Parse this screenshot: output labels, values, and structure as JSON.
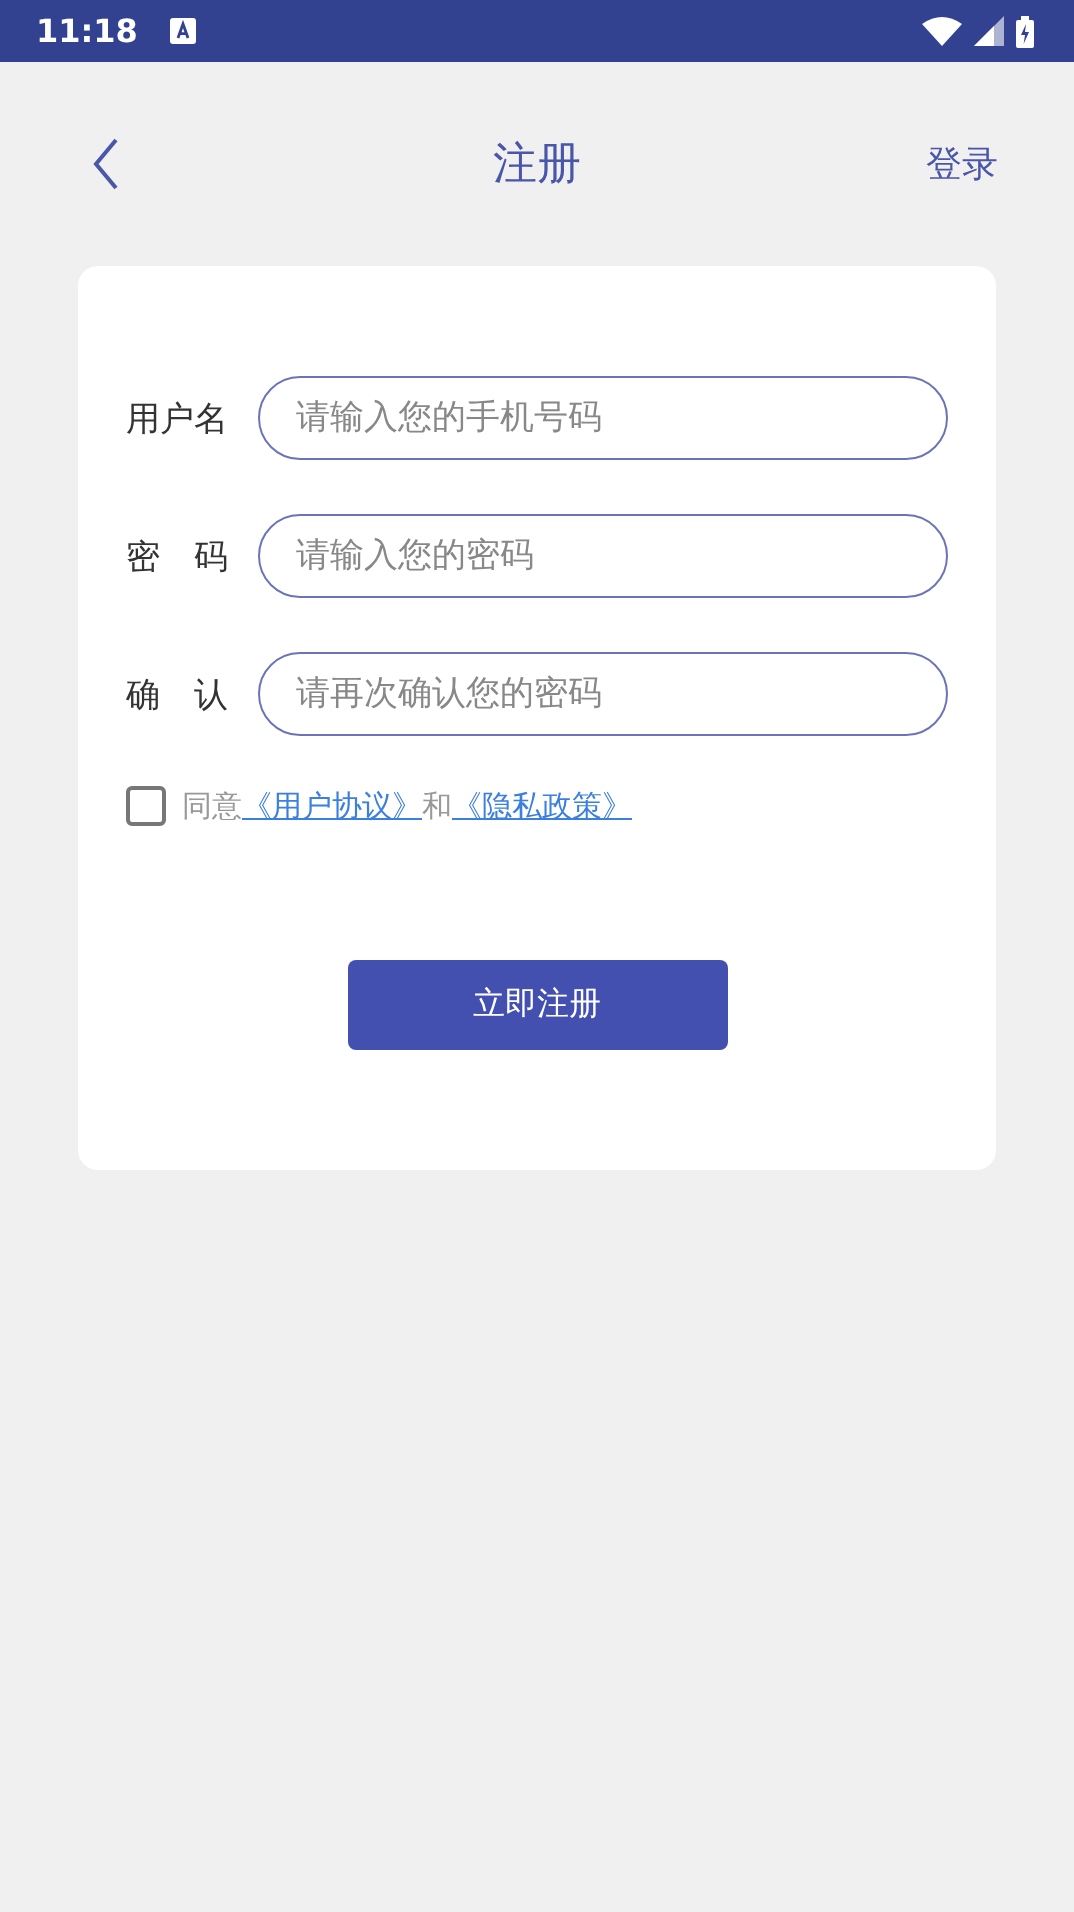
{
  "status_bar": {
    "time": "11:18"
  },
  "header": {
    "title": "注册",
    "action": "登录"
  },
  "fields": [
    {
      "label": "用户名",
      "placeholder": "请输入您的手机号码"
    },
    {
      "label": "密　码",
      "placeholder": "请输入您的密码"
    },
    {
      "label": "确　认",
      "placeholder": "请再次确认您的密码"
    }
  ],
  "agreement": {
    "checked": false,
    "prefix": "同意",
    "links": [
      "《用户协议》",
      "《隐私政策》"
    ],
    "joiner": "和"
  },
  "submit": "立即注册"
}
